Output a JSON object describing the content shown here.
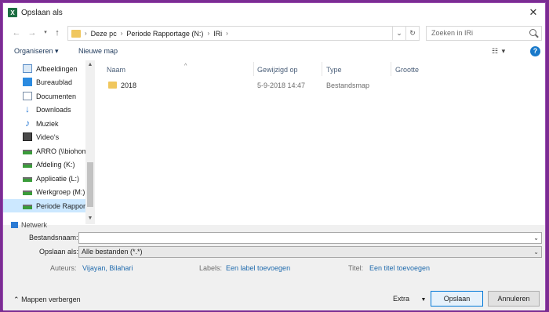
{
  "window": {
    "title": "Opslaan als",
    "app_icon_letter": "X"
  },
  "address": {
    "crumbs": [
      "Deze pc",
      "Periode Rapportage (N:)",
      "IRi"
    ],
    "search_placeholder": "Zoeken in IRi"
  },
  "toolbar": {
    "organize": "Organiseren ▾",
    "new_folder": "Nieuwe map"
  },
  "sidebar": {
    "items": [
      {
        "label": "Afbeeldingen",
        "icon": "pictures-icon"
      },
      {
        "label": "Bureaublad",
        "icon": "desktop-icon"
      },
      {
        "label": "Documenten",
        "icon": "documents-icon"
      },
      {
        "label": "Downloads",
        "icon": "downloads-icon"
      },
      {
        "label": "Muziek",
        "icon": "music-icon"
      },
      {
        "label": "Video's",
        "icon": "video-icon"
      },
      {
        "label": "ARRO (\\\\biohom",
        "icon": "network-drive-icon"
      },
      {
        "label": "Afdeling (K:)",
        "icon": "network-drive-icon"
      },
      {
        "label": "Applicatie (L:)",
        "icon": "network-drive-icon"
      },
      {
        "label": "Werkgroep (M:)",
        "icon": "network-drive-icon"
      },
      {
        "label": "Periode Rapport",
        "icon": "network-drive-icon"
      }
    ],
    "partial_item": "Netwerk"
  },
  "columns": [
    "Naam",
    "Gewijzigd op",
    "Type",
    "Grootte"
  ],
  "files": [
    {
      "name": "2018",
      "modified": "5-9-2018 14:47",
      "type": "Bestandsmap",
      "size": ""
    }
  ],
  "form": {
    "filename_label": "Bestandsnaam:",
    "filename_value": "",
    "savetype_label": "Opslaan als:",
    "savetype_value": "Alle bestanden (*.*)",
    "authors_label": "Auteurs:",
    "authors_value": "Vijayan, Bilahari",
    "labels_label": "Labels:",
    "labels_value": "Een label toevoegen",
    "title_label": "Titel:",
    "title_value": "Een titel toevoegen"
  },
  "footer": {
    "hide_folders": "Mappen verbergen",
    "extra": "Extra",
    "save": "Opslaan",
    "cancel": "Annuleren"
  }
}
